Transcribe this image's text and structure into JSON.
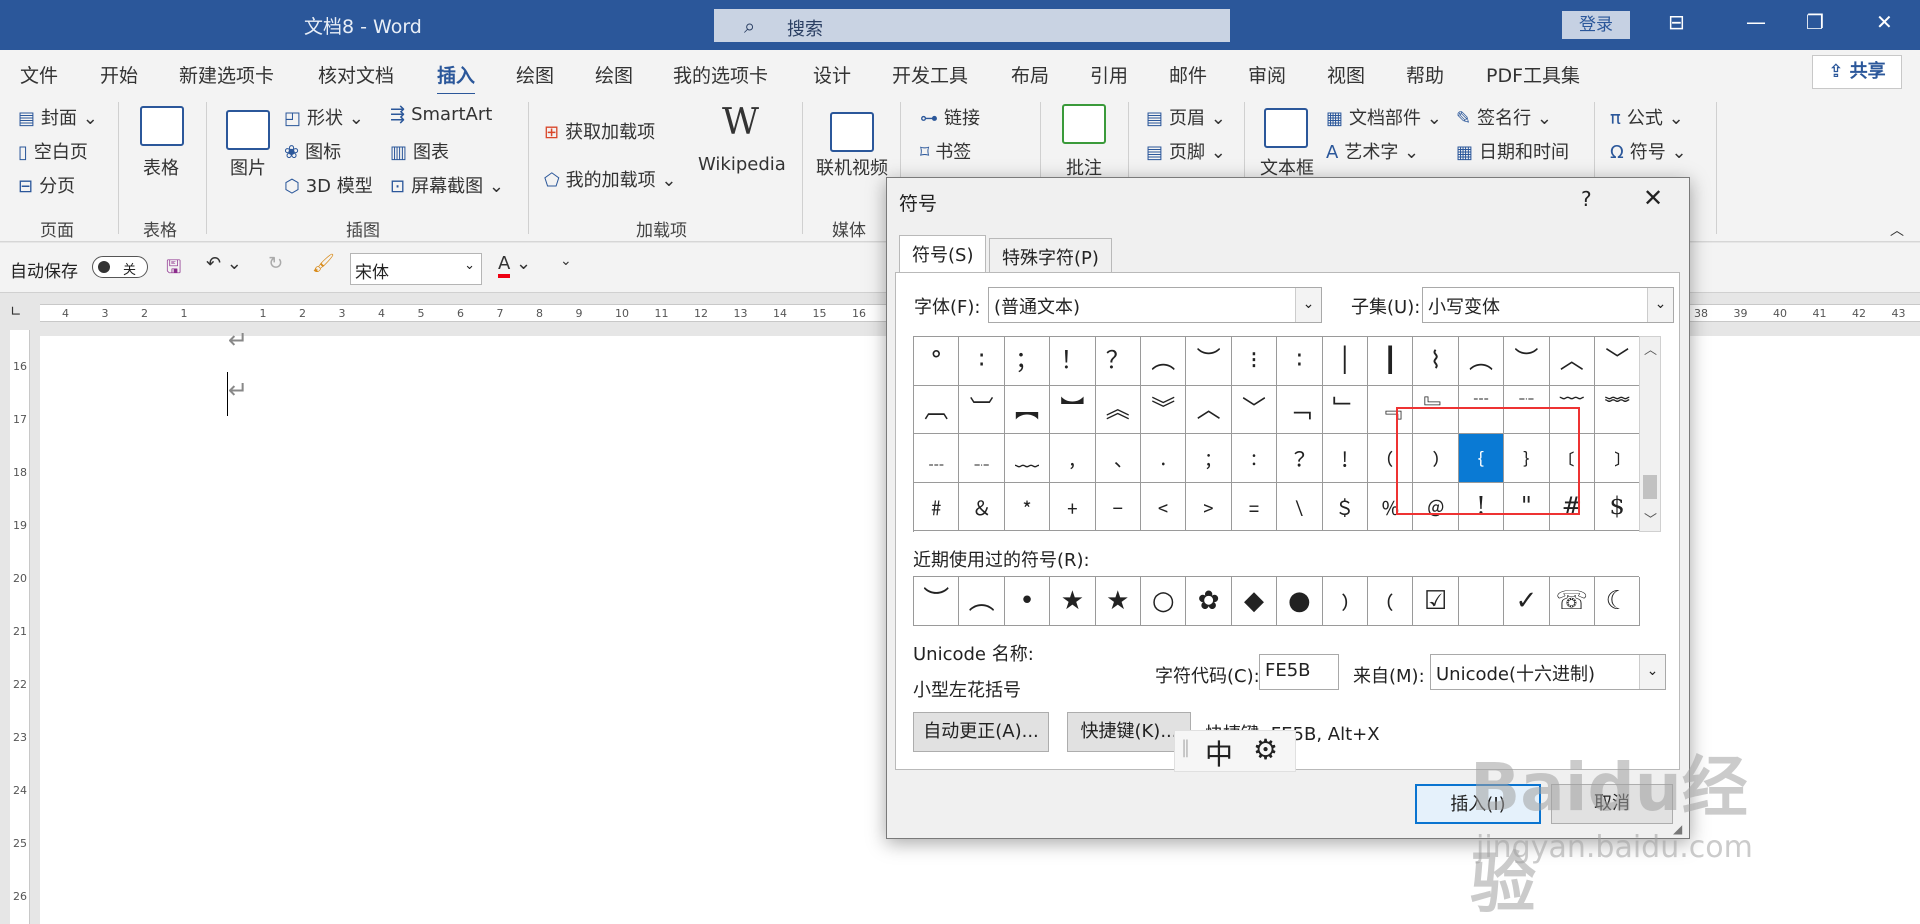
{
  "titlebar": {
    "title": "文档8  -  Word",
    "search_placeholder": "搜索",
    "login": "登录"
  },
  "menu": {
    "tabs": [
      "文件",
      "开始",
      "新建选项卡",
      "核对文档",
      "插入",
      "绘图",
      "绘图",
      "我的选项卡",
      "设计",
      "开发工具",
      "布局",
      "引用",
      "邮件",
      "审阅",
      "视图",
      "帮助",
      "PDF工具集"
    ],
    "active_tab": "插入",
    "share": "共享"
  },
  "ribbon": {
    "pages": {
      "cover": "封面",
      "blank": "空白页",
      "break": "分页",
      "group": "页面"
    },
    "table": {
      "label": "表格",
      "group": "表格"
    },
    "illustrations": {
      "picture": "图片",
      "shapes": "形状",
      "icons": "图标",
      "model3d": "3D 模型",
      "smartart": "SmartArt",
      "chart": "图表",
      "screenshot": "屏幕截图",
      "group": "插图"
    },
    "addins": {
      "get": "获取加载项",
      "my": "我的加载项",
      "wiki": "Wikipedia",
      "group": "加载项"
    },
    "media": {
      "video": "联机视频",
      "group": "媒体"
    },
    "links": {
      "link": "链接",
      "bookmark": "书签"
    },
    "comments": {
      "comment": "批注"
    },
    "header_footer": {
      "header": "页眉",
      "footer": "页脚"
    },
    "text": {
      "textbox": "文本框",
      "parts": "文档部件",
      "wordart": "艺术字",
      "signature": "签名行",
      "datetime": "日期和时间"
    },
    "symbols": {
      "equation": "公式",
      "symbol": "符号"
    }
  },
  "qat": {
    "autosave": "自动保存",
    "toggle": "关",
    "font": "宋体"
  },
  "ruler": {
    "h_ticks": [
      "4",
      "3",
      "2",
      "1",
      "",
      "1",
      "2",
      "3",
      "4",
      "5",
      "6",
      "7",
      "8",
      "9",
      "10",
      "11",
      "12",
      "13",
      "14",
      "15",
      "16"
    ],
    "h_ticks_right": [
      "38",
      "39",
      "40",
      "41",
      "42",
      "43"
    ],
    "v_ticks": [
      "16",
      "17",
      "18",
      "19",
      "20",
      "21",
      "22",
      "23",
      "24",
      "25",
      "26"
    ]
  },
  "dialog": {
    "title": "符号",
    "help": "?",
    "tabs": [
      "符号(S)",
      "特殊字符(P)"
    ],
    "font_label": "字体(F):",
    "font_value": "(普通文本)",
    "subset_label": "子集(U):",
    "subset_value": "小写变体",
    "grid": [
      [
        "°",
        "∶",
        "；",
        "！",
        "？",
        "︵",
        "︶",
        "⁝",
        "∶",
        "│",
        "┃",
        "⌇",
        "︵",
        "︶",
        "︿",
        "﹀"
      ],
      [
        "︹",
        "︺",
        "︻",
        "︼",
        "︽",
        "︾",
        "︿",
        "﹀",
        "﹁",
        "﹂",
        "﹃",
        "﹄",
        "﹉",
        "﹊",
        "﹋",
        "﹌"
      ],
      [
        "﹍",
        "﹎",
        "﹏",
        "﹐",
        "﹑",
        "﹒",
        "﹔",
        "﹕",
        "﹖",
        "﹗",
        "﹙",
        "﹚",
        "﹛",
        "﹜",
        "﹝",
        "﹞"
      ],
      [
        "﹟",
        "﹠",
        "﹡",
        "﹢",
        "﹣",
        "﹤",
        "﹥",
        "﹦",
        "﹨",
        "﹩",
        "﹪",
        "﹫",
        "!",
        "\"",
        "#",
        "$"
      ]
    ],
    "selected": [
      2,
      12
    ],
    "recent_label": "近期使用过的符号(R):",
    "recent": [
      "︶",
      "︵",
      "•",
      "★",
      "★",
      "○",
      "✿",
      "◆",
      "●",
      "﹚",
      "﹙",
      "☑",
      "",
      "✓",
      "☏",
      "☾"
    ],
    "unicode_name_label": "Unicode 名称:",
    "unicode_name": "小型左花括号",
    "code_label": "字符代码(C):",
    "code_value": "FE5B",
    "from_label": "来自(M):",
    "from_value": "Unicode(十六进制)",
    "autocorrect": "自动更正(A)...",
    "shortcut_key": "快捷键(K)...",
    "shortcut_text": "快捷键: FE5B, Alt+X",
    "insert": "插入(I)",
    "cancel": "取消"
  },
  "ime": {
    "mode": "中"
  },
  "watermark": {
    "brand": "Baidu经验",
    "url": "jingyan.baidu.com"
  }
}
